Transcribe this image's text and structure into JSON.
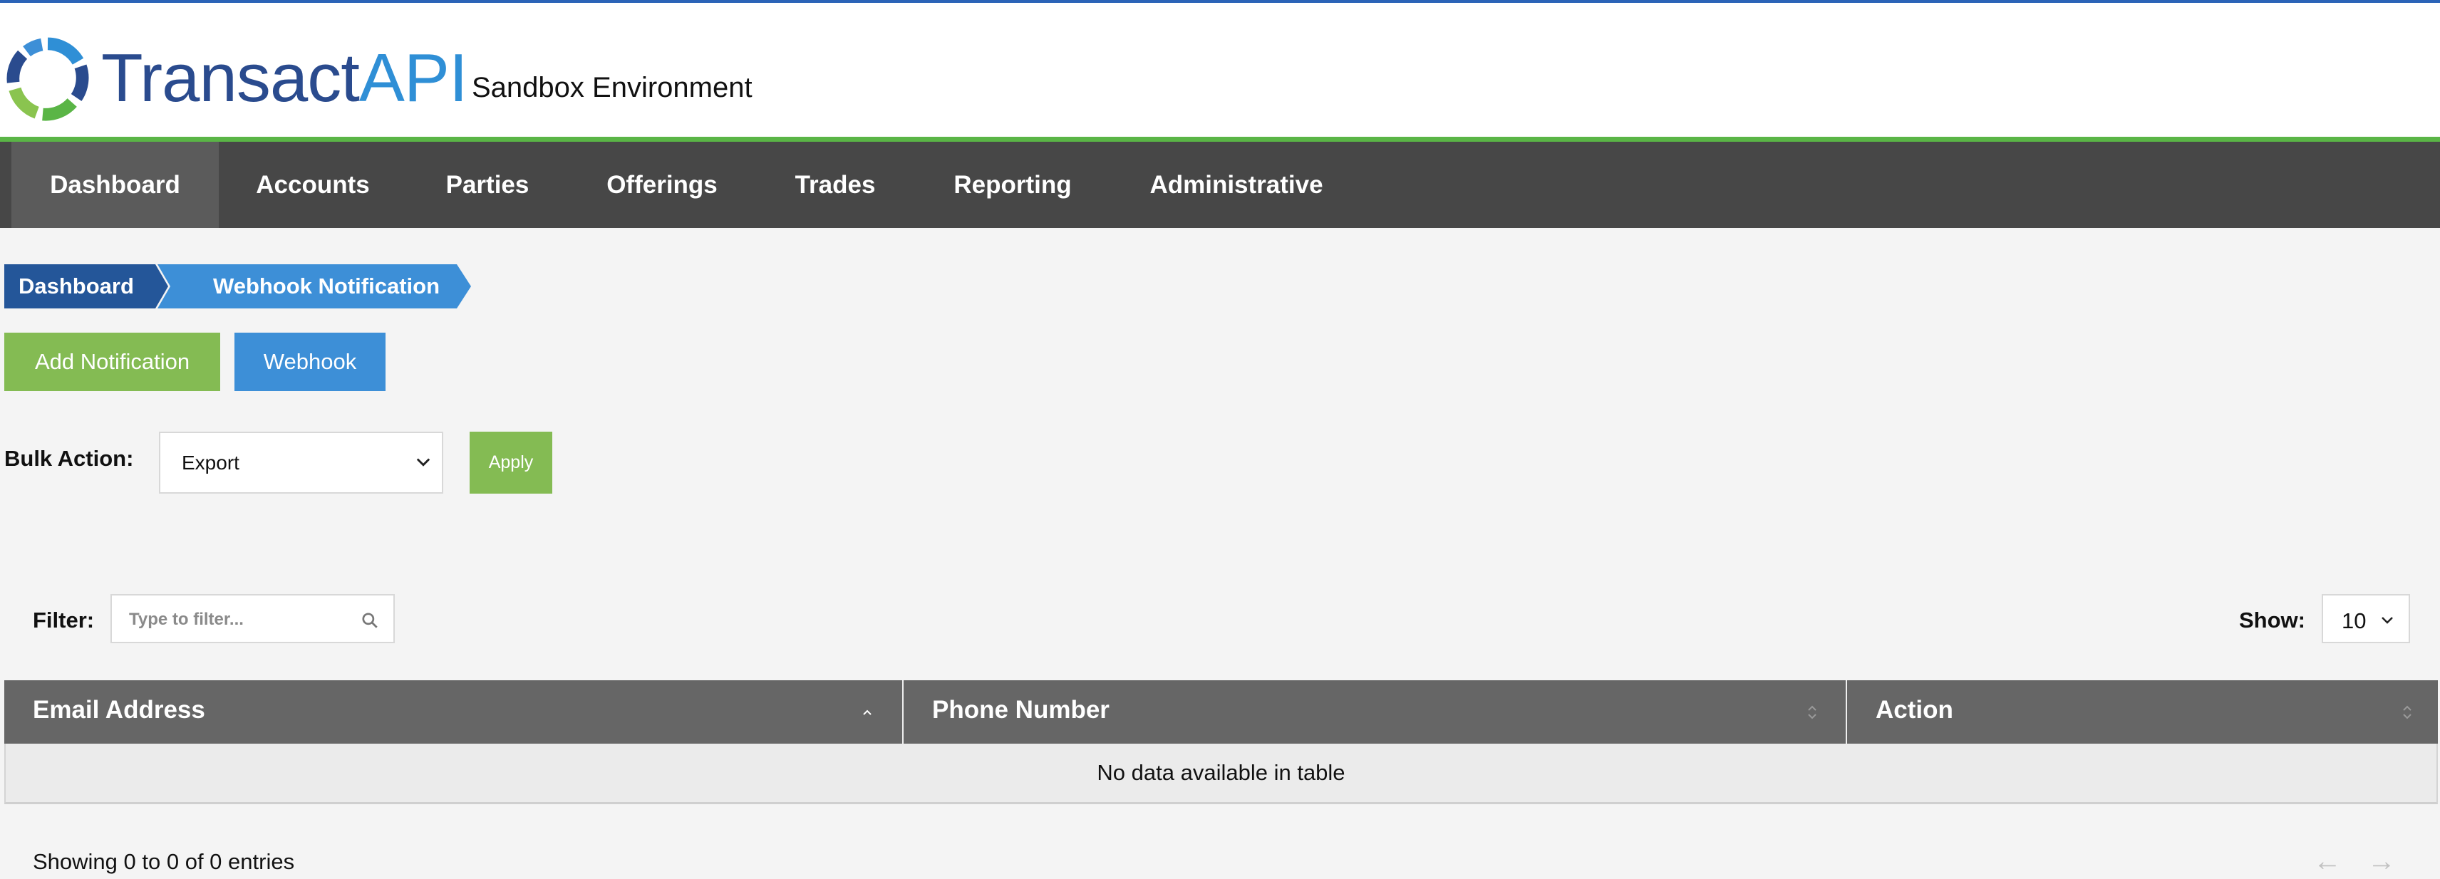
{
  "header": {
    "logo_text_part1": "Transact",
    "logo_text_part2": "API",
    "environment": "Sandbox Environment",
    "colors": {
      "top_line": "#2b63b7",
      "green_bar": "#5ab546",
      "logo_dark_blue": "#2a4b8e",
      "logo_light_blue": "#2f8fd6"
    }
  },
  "nav": {
    "items": [
      {
        "label": "Dashboard",
        "active": true
      },
      {
        "label": "Accounts",
        "active": false
      },
      {
        "label": "Parties",
        "active": false
      },
      {
        "label": "Offerings",
        "active": false
      },
      {
        "label": "Trades",
        "active": false
      },
      {
        "label": "Reporting",
        "active": false
      },
      {
        "label": "Administrative",
        "active": false
      }
    ]
  },
  "breadcrumb": {
    "items": [
      "Dashboard",
      "Webhook Notification"
    ]
  },
  "actions": {
    "add_notification_label": "Add Notification",
    "webhook_label": "Webhook"
  },
  "bulk_action": {
    "label": "Bulk Action:",
    "selected": "Export",
    "apply_label": "Apply"
  },
  "filter": {
    "label": "Filter:",
    "placeholder": "Type to filter...",
    "icon": "search-icon"
  },
  "show": {
    "label": "Show:",
    "selected": "10"
  },
  "table": {
    "columns": [
      "Email Address",
      "Phone Number",
      "Action"
    ],
    "empty_message": "No data available in table",
    "info": "Showing 0 to 0 of 0 entries",
    "prev_arrow": "←",
    "next_arrow": "→",
    "colors": {
      "header_bg": "#666666",
      "row_bg": "#ebebeb"
    }
  },
  "theme": {
    "green": "#84bb53",
    "blue": "#3d8fd7",
    "dark_blue": "#245699",
    "nav_bg": "#474747"
  }
}
